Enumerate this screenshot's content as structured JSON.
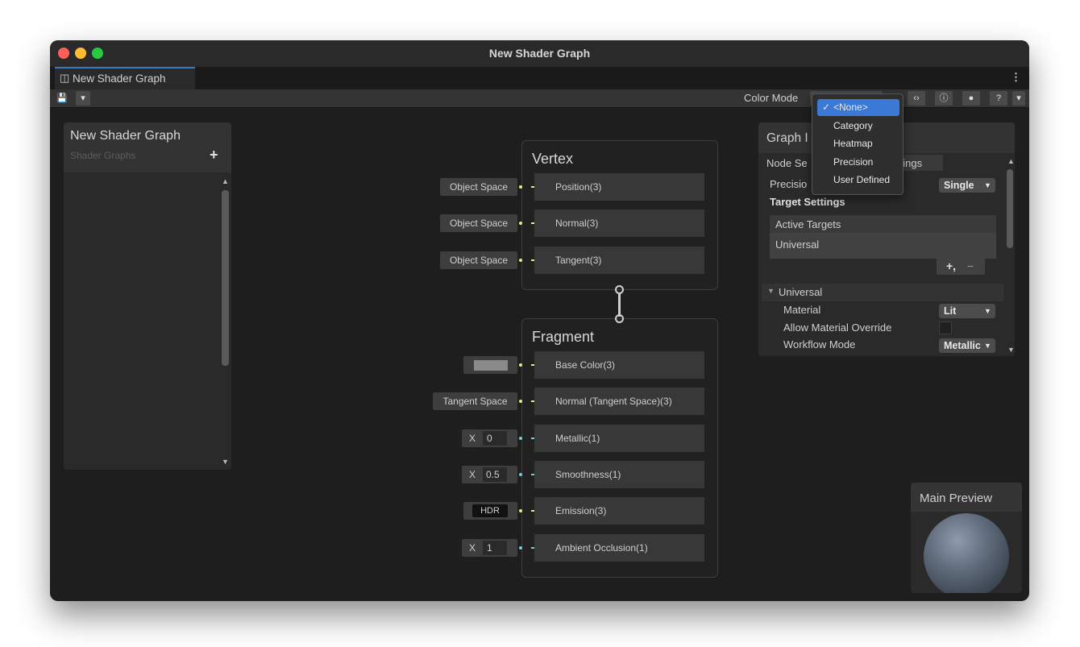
{
  "window": {
    "title": "New Shader Graph"
  },
  "tab": {
    "label": "New Shader Graph"
  },
  "toolbar": {
    "color_mode_label": "Color Mode",
    "color_mode_options": [
      "<None>",
      "Category",
      "Heatmap",
      "Precision",
      "User Defined"
    ],
    "color_mode_selected": "<None>"
  },
  "blackboard": {
    "title": "New Shader Graph",
    "subtitle": "Shader Graphs",
    "add_label": "+"
  },
  "vertex": {
    "title": "Vertex",
    "slots": [
      {
        "label": "Position(3)",
        "input": "Object Space",
        "color": "#e8e88e"
      },
      {
        "label": "Normal(3)",
        "input": "Object Space",
        "color": "#e8e88e"
      },
      {
        "label": "Tangent(3)",
        "input": "Object Space",
        "color": "#e8e88e"
      }
    ]
  },
  "fragment": {
    "title": "Fragment",
    "slots": [
      {
        "label": "Base Color(3)",
        "color": "#e8e88e"
      },
      {
        "label": "Normal (Tangent Space)(3)",
        "input": "Tangent Space",
        "color": "#e8e88e"
      },
      {
        "label": "Metallic(1)",
        "x_label": "X",
        "value": "0",
        "color": "#7ec8d6"
      },
      {
        "label": "Smoothness(1)",
        "x_label": "X",
        "value": "0.5",
        "color": "#7ec8d6"
      },
      {
        "label": "Emission(3)",
        "input": "HDR",
        "color": "#e8e88e"
      },
      {
        "label": "Ambient Occlusion(1)",
        "x_label": "X",
        "value": "1",
        "color": "#7ec8d6"
      }
    ]
  },
  "inspector": {
    "title": "Graph I",
    "tab_node": "Node Se",
    "tab_graph": "ttings",
    "precision_label": "Precisio",
    "precision_value": "Single",
    "target_settings": "Target Settings",
    "active_targets": "Active Targets",
    "target_item": "Universal",
    "add_remove": "+,",
    "remove": "−",
    "section": "Universal",
    "material_label": "Material",
    "material_value": "Lit",
    "allow_override_label": "Allow Material Override",
    "workflow_label": "Workflow Mode",
    "workflow_value": "Metallic"
  },
  "preview": {
    "title": "Main Preview"
  },
  "colors": {
    "vector3_port": "#e8e88e",
    "vector1_port": "#7ec8d6",
    "menu_highlight": "#3a79d6",
    "base_color_swatch": "#8a8a8a"
  }
}
